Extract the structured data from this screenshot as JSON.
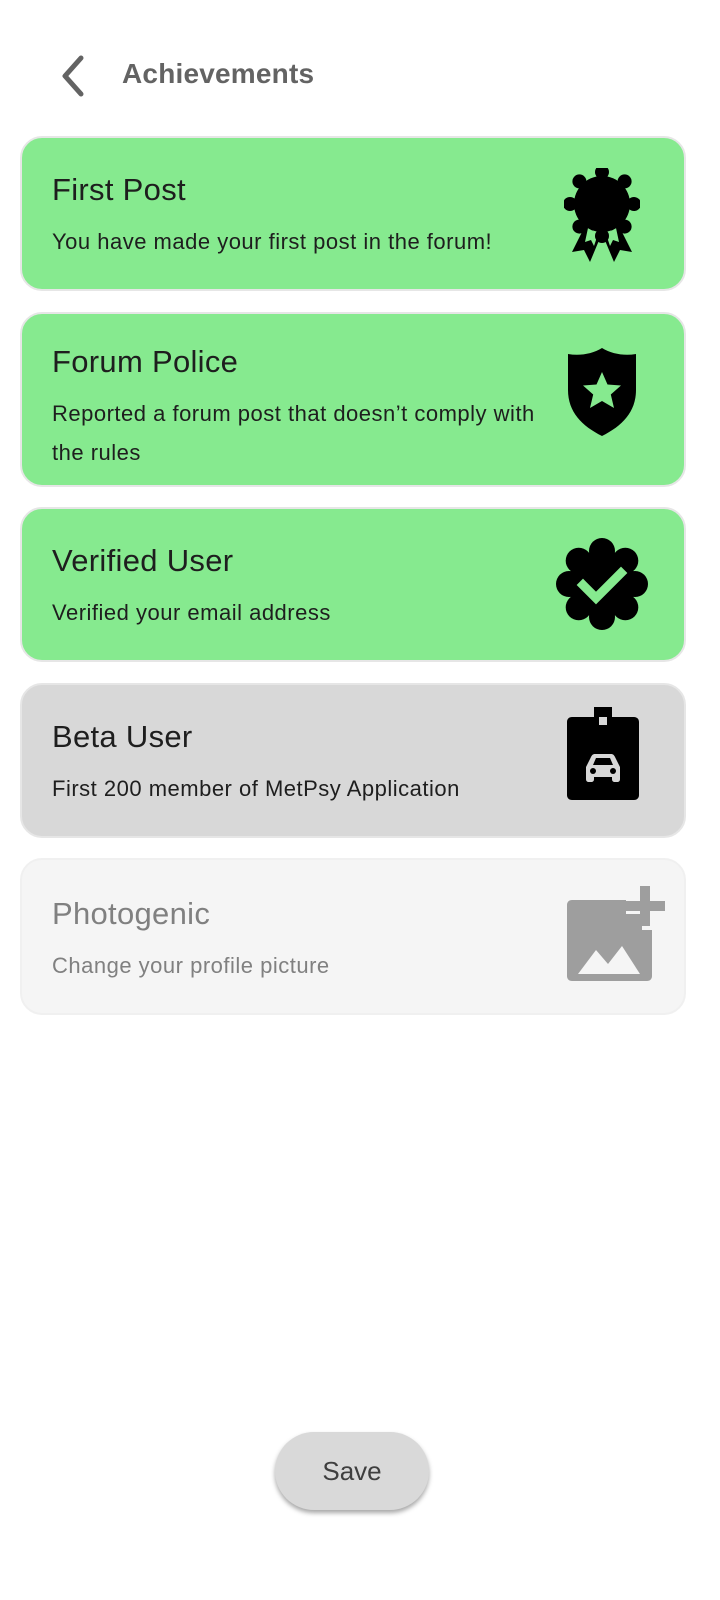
{
  "header": {
    "back_icon": "chevron-left-icon",
    "title": "Achievements"
  },
  "achievements": [
    {
      "title": "First Post",
      "description": "You have made your first post in the forum!",
      "icon": "award-ribbon-icon",
      "state": "earned"
    },
    {
      "title": "Forum Police",
      "description": "Reported a forum post that doesn’t comply with the rules",
      "icon": "police-badge-icon",
      "state": "earned"
    },
    {
      "title": "Verified User",
      "description": "Verified your email address",
      "icon": "verified-check-icon",
      "state": "earned"
    },
    {
      "title": "Beta User",
      "description": "First 200 member of MetPsy Application",
      "icon": "sim-card-car-icon",
      "state": "in-progress"
    },
    {
      "title": "Photogenic",
      "description": "Change your profile picture",
      "icon": "add-photo-icon",
      "state": "locked"
    }
  ],
  "footer": {
    "save_label": "Save"
  },
  "colors": {
    "earned": "#86ea8f",
    "in_progress": "#d8d8d8",
    "locked": "#f5f5f5",
    "title_text": "#636363"
  }
}
